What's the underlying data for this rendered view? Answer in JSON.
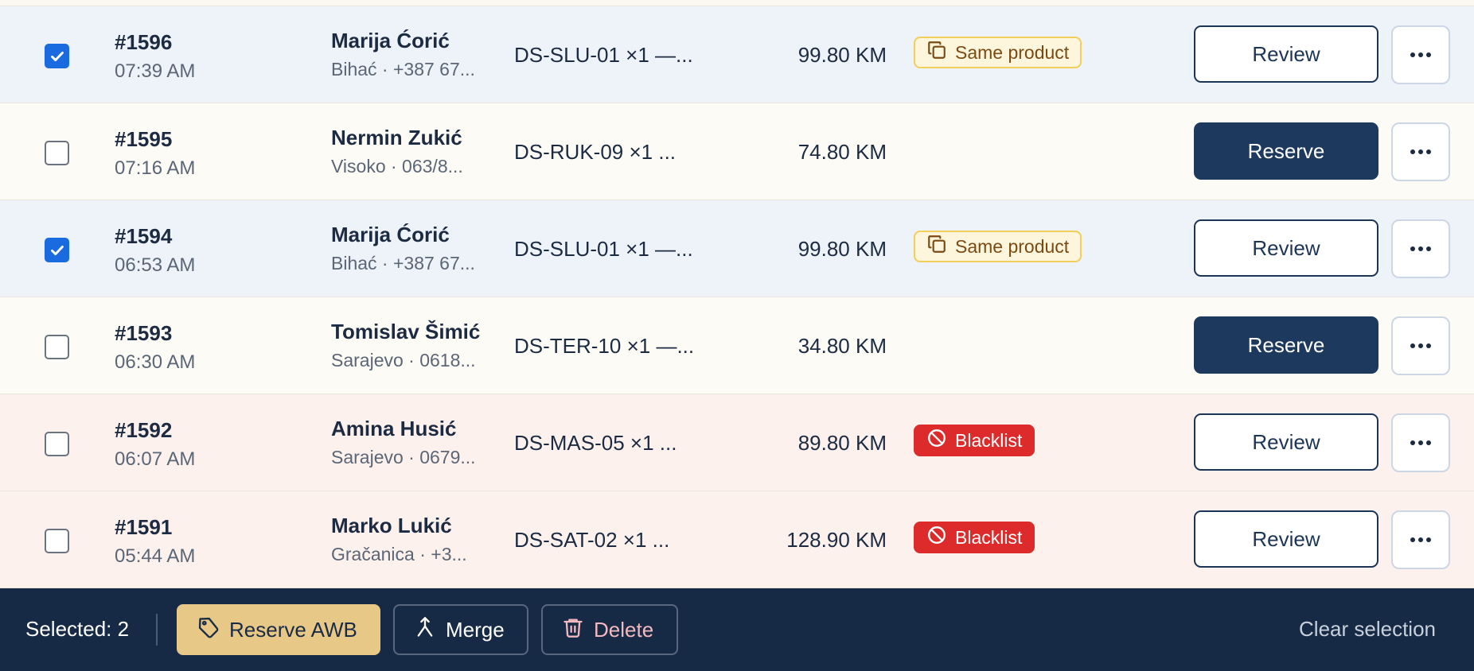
{
  "orders": [
    {
      "id": "#1596",
      "time": "07:39 AM",
      "name": "Marija Ćorić",
      "sub": "Bihać · +387 67...",
      "product": "DS-SLU-01 ×1 —...",
      "amount": "99.80 KM",
      "badge": "Same product",
      "badge_type": "same",
      "action": "Review",
      "action_type": "review",
      "checked": true,
      "row_state": "selected"
    },
    {
      "id": "#1595",
      "time": "07:16 AM",
      "name": "Nermin Zukić",
      "sub": "Visoko · 063/8...",
      "product": "DS-RUK-09 ×1 ...",
      "amount": "74.80 KM",
      "badge": "",
      "badge_type": "",
      "action": "Reserve",
      "action_type": "reserve",
      "checked": false,
      "row_state": "normal"
    },
    {
      "id": "#1594",
      "time": "06:53 AM",
      "name": "Marija Ćorić",
      "sub": "Bihać · +387 67...",
      "product": "DS-SLU-01 ×1 —...",
      "amount": "99.80 KM",
      "badge": "Same product",
      "badge_type": "same",
      "action": "Review",
      "action_type": "review",
      "checked": true,
      "row_state": "selected"
    },
    {
      "id": "#1593",
      "time": "06:30 AM",
      "name": "Tomislav Šimić",
      "sub": "Sarajevo · 0618...",
      "product": "DS-TER-10 ×1 —...",
      "amount": "34.80 KM",
      "badge": "",
      "badge_type": "",
      "action": "Reserve",
      "action_type": "reserve",
      "checked": false,
      "row_state": "normal"
    },
    {
      "id": "#1592",
      "time": "06:07 AM",
      "name": "Amina Husić",
      "sub": "Sarajevo · 0679...",
      "product": "DS-MAS-05 ×1 ...",
      "amount": "89.80 KM",
      "badge": "Blacklist",
      "badge_type": "black",
      "action": "Review",
      "action_type": "review",
      "checked": false,
      "row_state": "flagged"
    },
    {
      "id": "#1591",
      "time": "05:44 AM",
      "name": "Marko Lukić",
      "sub": "Gračanica · +3...",
      "product": "DS-SAT-02 ×1 ...",
      "amount": "128.90 KM",
      "badge": "Blacklist",
      "badge_type": "black",
      "action": "Review",
      "action_type": "review",
      "checked": false,
      "row_state": "flagged"
    }
  ],
  "bulk_bar": {
    "selected_label": "Selected: 2",
    "reserve_awb": "Reserve AWB",
    "merge": "Merge",
    "delete": "Delete",
    "clear": "Clear selection"
  },
  "icons": {
    "checkbox_check": "check-icon",
    "same_product": "copy-icon",
    "blacklist": "ban-icon",
    "more": "ellipsis-icon",
    "reserve_awb": "tag-icon",
    "merge": "merge-icon",
    "delete": "trash-icon"
  },
  "colors": {
    "primary_navy": "#1d3a5e",
    "checkbox_blue": "#1a6be0",
    "blacklist_red": "#dd2b2b",
    "same_product_yellow": "#f2cf5b",
    "bar_bg": "#172a45",
    "awb_gold": "#e8c886"
  }
}
